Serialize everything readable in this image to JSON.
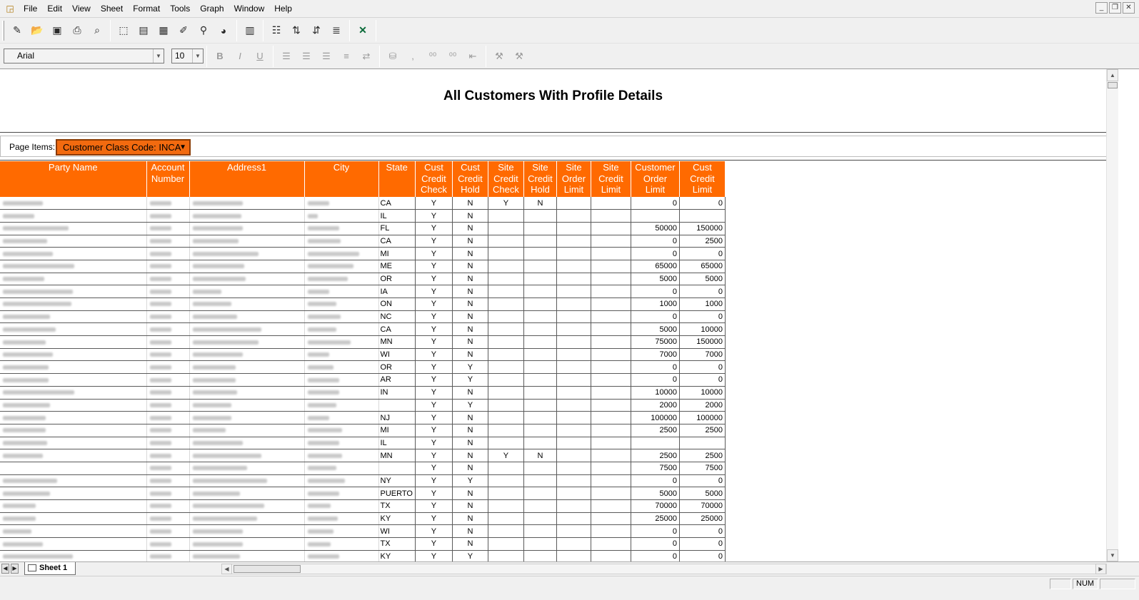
{
  "menu": [
    "File",
    "Edit",
    "View",
    "Sheet",
    "Format",
    "Tools",
    "Graph",
    "Window",
    "Help"
  ],
  "font_name": "Arial",
  "font_size": "10",
  "format_buttons": {
    "bold": "B",
    "italic": "I",
    "underline": "U"
  },
  "report": {
    "title": "All Customers With Profile Details",
    "page_items_label": "Page Items:",
    "page_item_value": "Customer Class Code: INCA",
    "columns": [
      [
        "Party Name"
      ],
      [
        "Account",
        "Number"
      ],
      [
        "Address1"
      ],
      [
        "City"
      ],
      [
        "State"
      ],
      [
        "Cust",
        "Credit",
        "Check"
      ],
      [
        "Cust",
        "Credit",
        "Hold"
      ],
      [
        "Site",
        "Credit",
        "Check"
      ],
      [
        "Site",
        "Credit",
        "Hold"
      ],
      [
        "Site",
        "Order",
        "Limit"
      ],
      [
        "Site",
        "Credit",
        "Limit"
      ],
      [
        "Customer",
        "Order",
        "Limit"
      ],
      [
        "Cust",
        "Credit",
        "Limit"
      ]
    ],
    "rows": [
      {
        "state": "CA",
        "ccc": "Y",
        "cch": "N",
        "scc": "Y",
        "sch": "N",
        "sol": "",
        "scl": "",
        "col": "0",
        "ccl": "0"
      },
      {
        "state": "IL",
        "ccc": "Y",
        "cch": "N",
        "scc": "",
        "sch": "",
        "sol": "",
        "scl": "",
        "col": "",
        "ccl": ""
      },
      {
        "state": "FL",
        "ccc": "Y",
        "cch": "N",
        "scc": "",
        "sch": "",
        "sol": "",
        "scl": "",
        "col": "50000",
        "ccl": "150000"
      },
      {
        "state": "CA",
        "ccc": "Y",
        "cch": "N",
        "scc": "",
        "sch": "",
        "sol": "",
        "scl": "",
        "col": "0",
        "ccl": "2500"
      },
      {
        "state": "MI",
        "ccc": "Y",
        "cch": "N",
        "scc": "",
        "sch": "",
        "sol": "",
        "scl": "",
        "col": "0",
        "ccl": "0"
      },
      {
        "state": "ME",
        "ccc": "Y",
        "cch": "N",
        "scc": "",
        "sch": "",
        "sol": "",
        "scl": "",
        "col": "65000",
        "ccl": "65000"
      },
      {
        "state": "OR",
        "ccc": "Y",
        "cch": "N",
        "scc": "",
        "sch": "",
        "sol": "",
        "scl": "",
        "col": "5000",
        "ccl": "5000"
      },
      {
        "state": "IA",
        "ccc": "Y",
        "cch": "N",
        "scc": "",
        "sch": "",
        "sol": "",
        "scl": "",
        "col": "0",
        "ccl": "0"
      },
      {
        "state": "ON",
        "ccc": "Y",
        "cch": "N",
        "scc": "",
        "sch": "",
        "sol": "",
        "scl": "",
        "col": "1000",
        "ccl": "1000"
      },
      {
        "state": "NC",
        "ccc": "Y",
        "cch": "N",
        "scc": "",
        "sch": "",
        "sol": "",
        "scl": "",
        "col": "0",
        "ccl": "0"
      },
      {
        "state": "CA",
        "ccc": "Y",
        "cch": "N",
        "scc": "",
        "sch": "",
        "sol": "",
        "scl": "",
        "col": "5000",
        "ccl": "10000"
      },
      {
        "state": "MN",
        "ccc": "Y",
        "cch": "N",
        "scc": "",
        "sch": "",
        "sol": "",
        "scl": "",
        "col": "75000",
        "ccl": "150000"
      },
      {
        "state": "WI",
        "ccc": "Y",
        "cch": "N",
        "scc": "",
        "sch": "",
        "sol": "",
        "scl": "",
        "col": "7000",
        "ccl": "7000"
      },
      {
        "state": "OR",
        "ccc": "Y",
        "cch": "Y",
        "scc": "",
        "sch": "",
        "sol": "",
        "scl": "",
        "col": "0",
        "ccl": "0"
      },
      {
        "state": "AR",
        "ccc": "Y",
        "cch": "Y",
        "scc": "",
        "sch": "",
        "sol": "",
        "scl": "",
        "col": "0",
        "ccl": "0"
      },
      {
        "state": "IN",
        "ccc": "Y",
        "cch": "N",
        "scc": "",
        "sch": "",
        "sol": "",
        "scl": "",
        "col": "10000",
        "ccl": "10000"
      },
      {
        "state": "",
        "ccc": "Y",
        "cch": "Y",
        "scc": "",
        "sch": "",
        "sol": "",
        "scl": "",
        "col": "2000",
        "ccl": "2000"
      },
      {
        "state": "NJ",
        "ccc": "Y",
        "cch": "N",
        "scc": "",
        "sch": "",
        "sol": "",
        "scl": "",
        "col": "100000",
        "ccl": "100000"
      },
      {
        "state": "MI",
        "ccc": "Y",
        "cch": "N",
        "scc": "",
        "sch": "",
        "sol": "",
        "scl": "",
        "col": "2500",
        "ccl": "2500"
      },
      {
        "state": "IL",
        "ccc": "Y",
        "cch": "N",
        "scc": "",
        "sch": "",
        "sol": "",
        "scl": "",
        "col": "",
        "ccl": ""
      },
      {
        "state": "MN",
        "ccc": "Y",
        "cch": "N",
        "scc": "Y",
        "sch": "N",
        "sol": "",
        "scl": "",
        "col": "2500",
        "ccl": "2500"
      },
      {
        "state": "",
        "ccc": "Y",
        "cch": "N",
        "scc": "",
        "sch": "",
        "sol": "",
        "scl": "",
        "col": "7500",
        "ccl": "7500"
      },
      {
        "state": "NY",
        "ccc": "Y",
        "cch": "Y",
        "scc": "",
        "sch": "",
        "sol": "",
        "scl": "",
        "col": "0",
        "ccl": "0"
      },
      {
        "state": "PUERTO",
        "ccc": "Y",
        "cch": "N",
        "scc": "",
        "sch": "",
        "sol": "",
        "scl": "",
        "col": "5000",
        "ccl": "5000"
      },
      {
        "state": "TX",
        "ccc": "Y",
        "cch": "N",
        "scc": "",
        "sch": "",
        "sol": "",
        "scl": "",
        "col": "70000",
        "ccl": "70000"
      },
      {
        "state": "KY",
        "ccc": "Y",
        "cch": "N",
        "scc": "",
        "sch": "",
        "sol": "",
        "scl": "",
        "col": "25000",
        "ccl": "25000"
      },
      {
        "state": "WI",
        "ccc": "Y",
        "cch": "N",
        "scc": "",
        "sch": "",
        "sol": "",
        "scl": "",
        "col": "0",
        "ccl": "0"
      },
      {
        "state": "TX",
        "ccc": "Y",
        "cch": "N",
        "scc": "",
        "sch": "",
        "sol": "",
        "scl": "",
        "col": "0",
        "ccl": "0"
      },
      {
        "state": "KY",
        "ccc": "Y",
        "cch": "Y",
        "scc": "",
        "sch": "",
        "sol": "",
        "scl": "",
        "col": "0",
        "ccl": "0"
      }
    ]
  },
  "sheet_tab": "Sheet 1",
  "status": {
    "num": "NUM"
  },
  "colors": {
    "header_bg": "#ff6a00",
    "header_text": "#ffffff",
    "page_item_bg": "#f26a0f"
  }
}
